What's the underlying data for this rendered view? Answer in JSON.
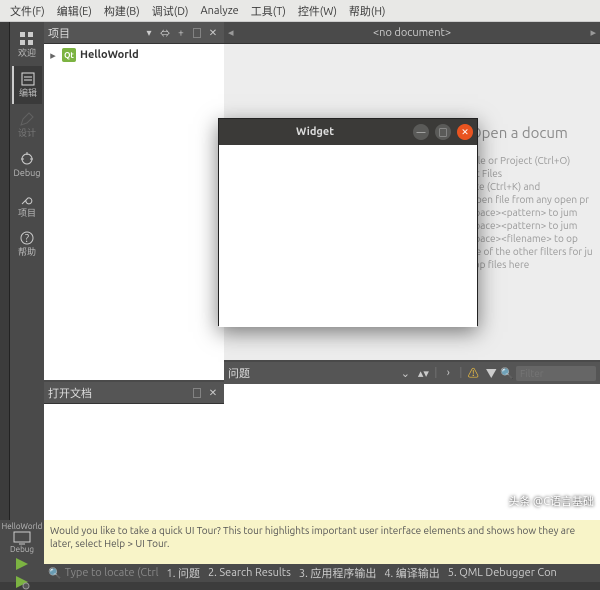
{
  "menu": [
    "文件(F)",
    "编辑(E)",
    "构建(B)",
    "调试(D)",
    "Analyze",
    "工具(T)",
    "控件(W)",
    "帮助(H)"
  ],
  "activity": {
    "welcome": "欢迎",
    "edit": "编辑",
    "design": "设计",
    "debug": "Debug",
    "projects": "项目",
    "help": "帮助"
  },
  "project_panel": {
    "title": "项目",
    "item": "HelloWorld"
  },
  "open_docs": {
    "title": "打开文档"
  },
  "tabbar": {
    "nodoc": "<no document>"
  },
  "welcome": {
    "heading": "Open a docum",
    "lines": [
      "File or Project (Ctrl+O)",
      "nt Files",
      "ate (Ctrl+K) and",
      "open file from any open pr",
      "space><pattern> to jum",
      "space><pattern> to jum",
      "space><filename> to op",
      "ne of the other filters for ju",
      "rop files here"
    ]
  },
  "problems": {
    "title": "问题",
    "filter_ph": "Filter"
  },
  "widget": {
    "title": "Widget",
    "min": "—",
    "max": "□",
    "close": "✕"
  },
  "kit": {
    "name": "HelloWorld",
    "config": "Debug"
  },
  "tour": "Would you like to take a quick UI Tour? This tour highlights important user interface elements and shows how they are later, select Help > UI Tour.",
  "status": {
    "locate_hint": "Type to locate (Ctrl",
    "tabs": [
      "1. 问题",
      "2. Search Results",
      "3. 应用程序输出",
      "4. 编译输出",
      "5. QML Debugger Con"
    ]
  },
  "watermark": "头条 @C语言基础"
}
